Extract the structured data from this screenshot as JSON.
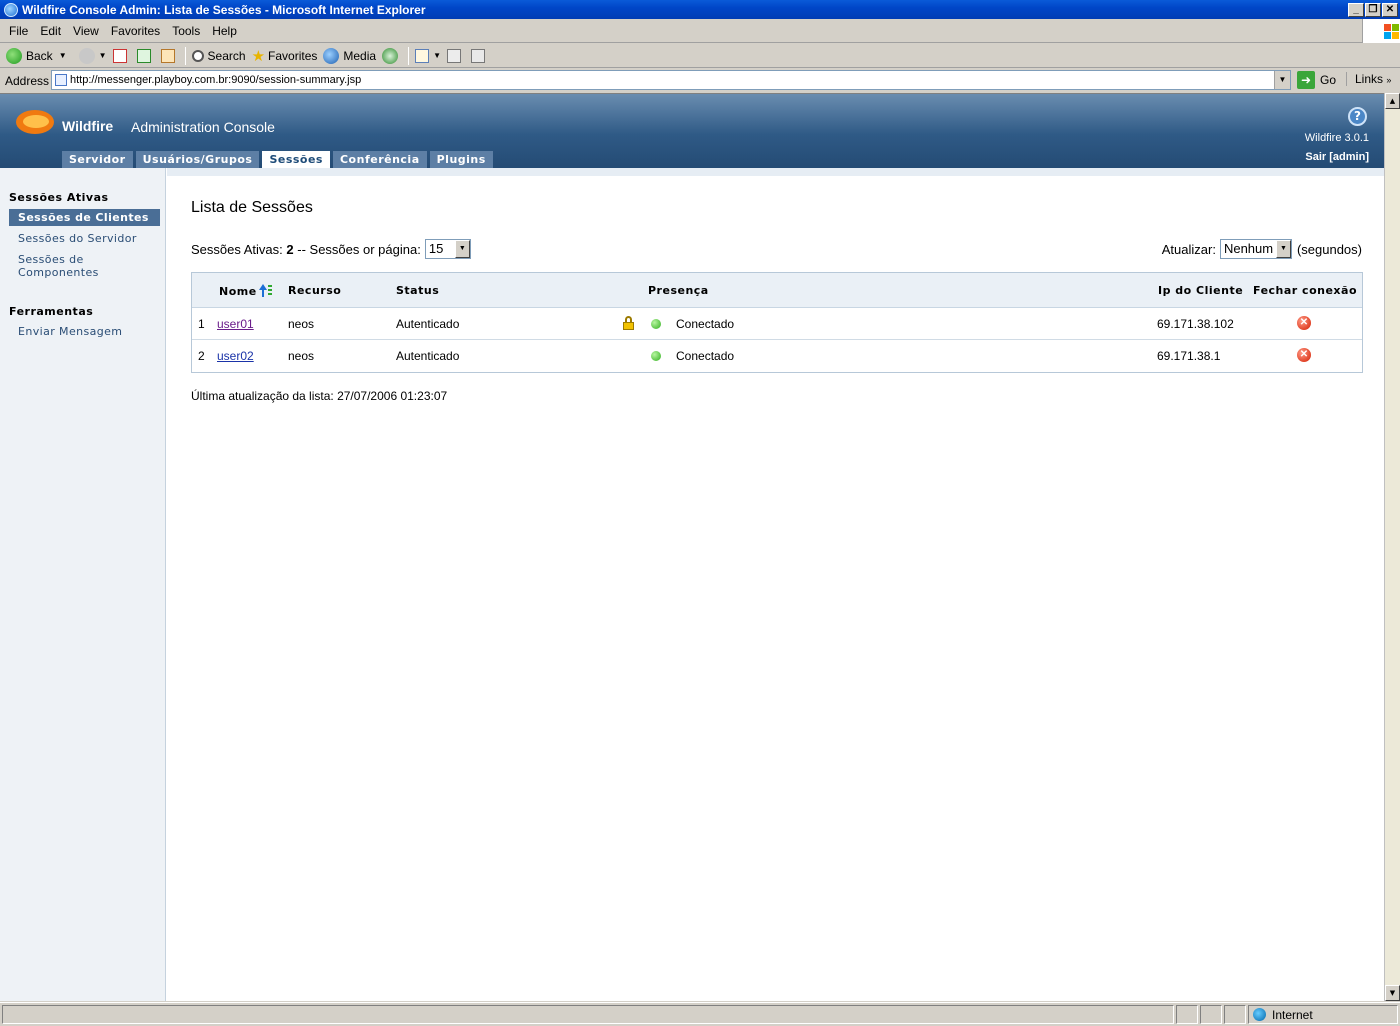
{
  "window": {
    "title": "Wildfire Console Admin: Lista de Sessões - Microsoft Internet Explorer",
    "controls": {
      "minimize": "_",
      "restore": "❐",
      "close": "✕"
    }
  },
  "menu": [
    "File",
    "Edit",
    "View",
    "Favorites",
    "Tools",
    "Help"
  ],
  "toolbar": {
    "back": "Back",
    "search": "Search",
    "favorites": "Favorites",
    "media": "Media"
  },
  "address": {
    "label": "Address",
    "url": "http://messenger.playboy.com.br:9090/session-summary.jsp",
    "go": "Go",
    "links": "Links"
  },
  "status": {
    "zone": "Internet"
  },
  "header": {
    "brand": "Wildfire",
    "title": "Administration Console",
    "help": "?",
    "version": "Wildfire 3.0.1",
    "logout": "Sair [admin]"
  },
  "tabs": [
    {
      "label": "Servidor"
    },
    {
      "label": "Usuários/Grupos"
    },
    {
      "label": "Sessões",
      "active": true
    },
    {
      "label": "Conferência"
    },
    {
      "label": "Plugins"
    }
  ],
  "sidebar": {
    "section1": "Sessões Ativas",
    "items1": [
      "Sessões de Clientes",
      "Sessões do Servidor",
      "Sessões de Componentes"
    ],
    "section2": "Ferramentas",
    "items2": [
      "Enviar Mensagem"
    ]
  },
  "main": {
    "title": "Lista de Sessões",
    "active_label": "Sessões Ativas:",
    "active_count": "2",
    "per_page_label": "-- Sessões or página:",
    "per_page_value": "15",
    "refresh_label": "Atualizar:",
    "refresh_value": "Nenhum",
    "refresh_unit": "(segundos)",
    "last_update": "Última atualização da lista: 27/07/2006 01:23:07"
  },
  "table": {
    "columns": {
      "name": "Nome",
      "resource": "Recurso",
      "status": "Status",
      "presence": "Presença",
      "ip": "Ip do Cliente",
      "close": "Fechar conexão"
    },
    "rows": [
      {
        "index": "1",
        "name": "user01",
        "resource": "neos",
        "status": "Autenticado",
        "secure": true,
        "presence": "Conectado",
        "ip": "69.171.38.102"
      },
      {
        "index": "2",
        "name": "user02",
        "resource": "neos",
        "status": "Autenticado",
        "secure": false,
        "presence": "Conectado",
        "ip": "69.171.38.1"
      }
    ]
  },
  "colors": {
    "header_dark": "#244b74",
    "tab": "#5d7fa5",
    "sidebar_active": "#4a6e96",
    "link": "#1a33a8"
  }
}
